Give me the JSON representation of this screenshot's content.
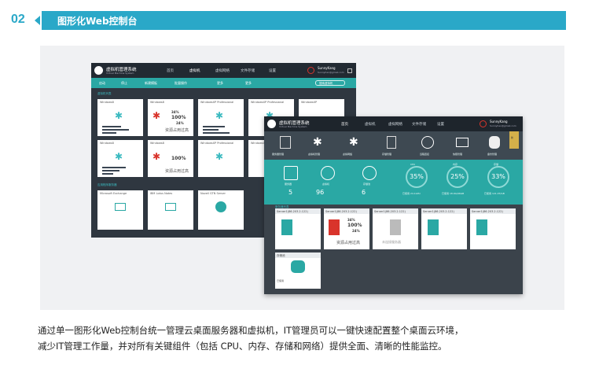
{
  "header": {
    "number": "02",
    "title": "图形化Web控制台"
  },
  "screen_back": {
    "app_title": "虚拟机管理系统",
    "app_subtitle": "Virtual Machine System",
    "nav": [
      "首页",
      "虚拟机",
      "虚拟网络",
      "文件存储",
      "设置"
    ],
    "user_name": "SunnyKang",
    "user_email": "Sunnyhao@gmail.com",
    "toolbar": [
      "启动",
      "停止",
      "新建模板",
      "批量操作",
      "更多"
    ],
    "search_placeholder": "搜索虚拟机",
    "section_vms": "虚拟机列表",
    "section_apps": "应用程序服务器",
    "vm_cards": [
      {
        "name": "Windows8"
      },
      {
        "name": "Windows8"
      },
      {
        "name": "WindowsXP Professional"
      },
      {
        "name": "WindowsXP Professional"
      },
      {
        "name": "WindowsXP"
      },
      {
        "name": "Windows8"
      },
      {
        "name": "Windows8"
      },
      {
        "name": "WindowsXP Professional"
      },
      {
        "name": "WindowsXP Professional"
      }
    ],
    "busy_text": "资源占用过高",
    "metrics": {
      "cpu": "34%",
      "mem": "100%",
      "disk": "24%"
    },
    "app_cards": [
      {
        "name": "Microsoft Exchange"
      },
      {
        "name": "IBM Lotus Notes"
      },
      {
        "name": "Novell GTN Server"
      }
    ]
  },
  "screen_front": {
    "app_title": "虚拟机管理系统",
    "app_subtitle": "Virtual Machine System",
    "nav": [
      "首页",
      "虚拟机",
      "虚拟网络",
      "文件存储",
      "设置"
    ],
    "user_name": "SunnyKang",
    "user_email": "Sunnyhao@gmail.com",
    "banner_items": [
      "服务器管理",
      "虚拟机管理",
      "虚拟网络",
      "存储管理",
      "远程连接",
      "快照管理",
      "备份管理"
    ],
    "banner_badge": "新",
    "stats": [
      {
        "label": "服务器",
        "value": "5"
      },
      {
        "label": "虚拟机",
        "value": "96"
      },
      {
        "label": "存储池",
        "value": "6"
      }
    ],
    "rings": [
      {
        "label": "CPU",
        "value": "35%",
        "sub": "已使用 24.1GHz"
      },
      {
        "label": "内存",
        "value": "25%",
        "sub": "已使用 18.9G/96GB"
      },
      {
        "label": "存储",
        "value": "33%",
        "sub": "已使用 121.0T/GB"
      }
    ],
    "section_servers": "服务器列表",
    "servers": [
      "Server1(86.203.2.122)",
      "Server1(86.203.2.122)",
      "Server1(86.203.2.122)",
      "Server1(86.203.2.122)",
      "Server1(86.203.2.122)"
    ],
    "busy_text": "资源占用过高",
    "offline_text": "未连接服务器",
    "metrics": {
      "cpu": "34%",
      "mem": "100%",
      "disk": "24%"
    },
    "storage_label": "存储池",
    "storage_used": "已使用"
  },
  "caption": {
    "line1": "通过单一图形化Web控制台统一管理云桌面服务器和虚拟机，IT管理员可以一键快速配置整个桌面云环境，",
    "line2": "减少IT管理工作量，并对所有关键组件（包括 CPU、内存、存储和网络）提供全面、清晰的性能监控。"
  },
  "colors": {
    "accent": "#2aa8c8",
    "teal": "#2aa8a4",
    "dark": "#2f3740",
    "alert": "#d9342b"
  }
}
